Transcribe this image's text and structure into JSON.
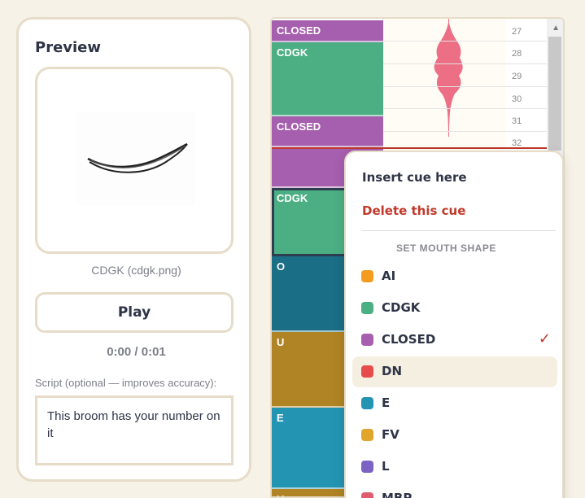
{
  "preview": {
    "title": "Preview",
    "caption": "CDGK  (cdgk.png)",
    "play_label": "Play",
    "time": "0:00 / 0:01",
    "script_label": "Script (optional — improves accuracy):",
    "script_text": "This broom has your number on it"
  },
  "timeline": {
    "frames": [
      "27",
      "28",
      "29",
      "30",
      "31",
      "32"
    ],
    "cues": [
      {
        "label": "CLOSED",
        "color": "#a65fae"
      },
      {
        "label": "CDGK",
        "color": "#4caf84"
      },
      {
        "label": "CLOSED",
        "color": "#a65fae"
      },
      {
        "label": "",
        "color": "#a65fae"
      },
      {
        "label": "CDGK",
        "color": "#4caf84"
      },
      {
        "label": "O",
        "color": "#1a6e86"
      },
      {
        "label": "U",
        "color": "#b08424"
      },
      {
        "label": "E",
        "color": "#2494b3"
      },
      {
        "label": "U",
        "color": "#b08424"
      }
    ],
    "waveform_color": "#ec6f85",
    "playhead_color": "#c0392b"
  },
  "context_menu": {
    "insert_label": "Insert cue here",
    "delete_label": "Delete this cue",
    "heading": "SET MOUTH SHAPE",
    "check_icon": "✓",
    "selected": "CLOSED",
    "hovered": "DN",
    "shapes": [
      {
        "label": "AI",
        "color": "#f39c1f"
      },
      {
        "label": "CDGK",
        "color": "#4caf84"
      },
      {
        "label": "CLOSED",
        "color": "#a65fae"
      },
      {
        "label": "DN",
        "color": "#e74c4c"
      },
      {
        "label": "E",
        "color": "#2494b3"
      },
      {
        "label": "FV",
        "color": "#e0a52a"
      },
      {
        "label": "L",
        "color": "#7b62c4"
      },
      {
        "label": "MBP",
        "color": "#e05c6e"
      }
    ]
  }
}
